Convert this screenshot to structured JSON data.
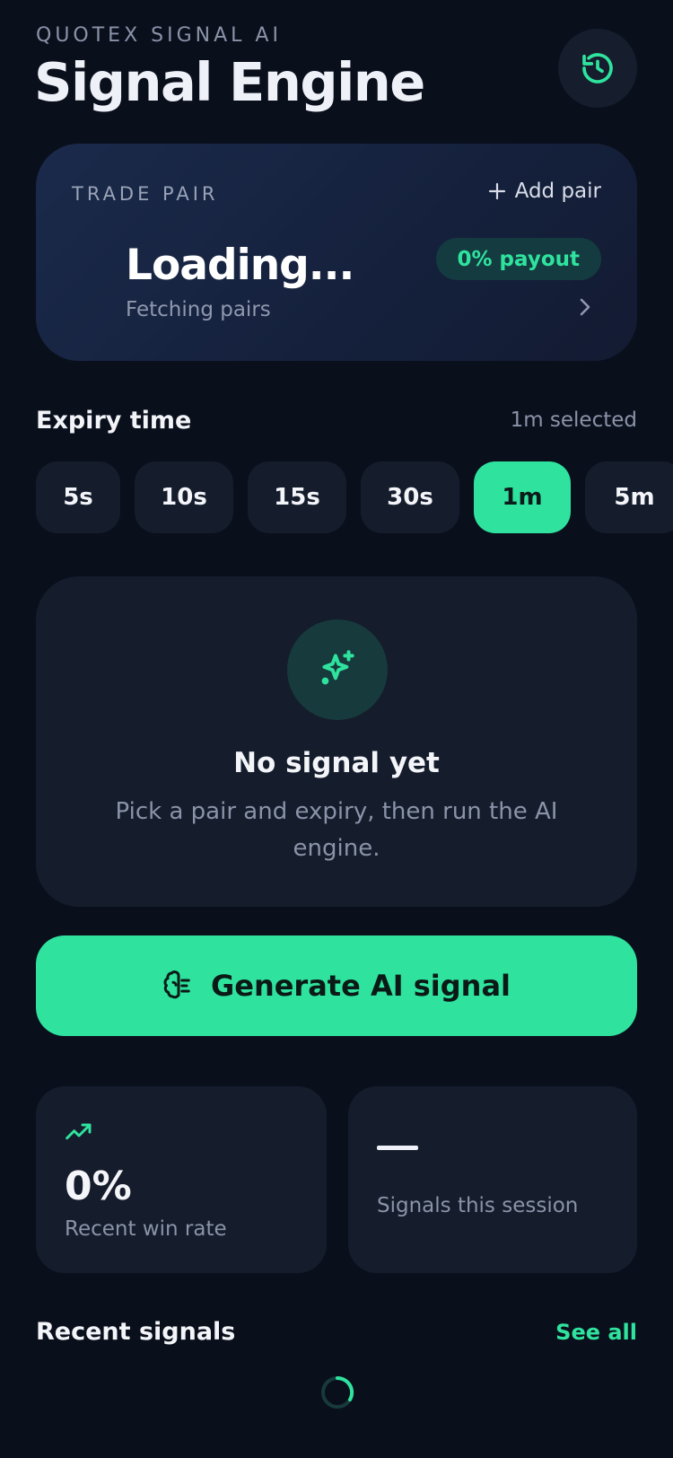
{
  "header": {
    "brand": "QUOTEX SIGNAL AI",
    "title": "Signal Engine",
    "history_icon": "history-icon"
  },
  "trade_pair": {
    "label": "TRADE PAIR",
    "add_label": "Add pair",
    "name": "Loading...",
    "subtitle": "Fetching pairs",
    "payout": "0% payout"
  },
  "expiry": {
    "title": "Expiry time",
    "selected_text": "1m selected",
    "options": [
      "5s",
      "10s",
      "15s",
      "30s",
      "1m",
      "5m"
    ],
    "active": "1m"
  },
  "empty_state": {
    "icon": "sparkle-icon",
    "title": "No signal yet",
    "description": "Pick a pair and expiry, then run the AI engine."
  },
  "generate": {
    "icon": "brain-icon",
    "label": "Generate AI signal"
  },
  "stats": {
    "win_rate": {
      "icon": "trending-up-icon",
      "value": "0%",
      "label": "Recent win rate"
    },
    "session": {
      "value": "—",
      "label": "Signals this session"
    }
  },
  "recent": {
    "title": "Recent signals",
    "see_all": "See all"
  },
  "colors": {
    "background": "#0a0f1c",
    "accent": "#2fe39e",
    "card": "#151c2c"
  }
}
